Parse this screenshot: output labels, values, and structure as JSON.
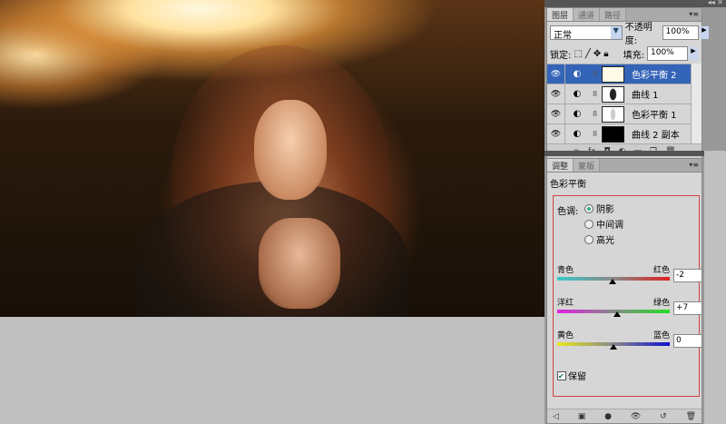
{
  "layers_panel": {
    "tabs": [
      "图层",
      "通道",
      "路径"
    ],
    "blend_mode": "正常",
    "opacity_label": "不透明度:",
    "opacity": "100%",
    "lock_label": "锁定:",
    "fill_label": "填充:",
    "fill": "100%",
    "layers": [
      {
        "name": "色彩平衡 2",
        "selected": true
      },
      {
        "name": "曲线 1",
        "selected": false
      },
      {
        "name": "色彩平衡 1",
        "selected": false
      },
      {
        "name": "曲线 2 副本",
        "selected": false
      }
    ]
  },
  "adjustments_panel": {
    "tabs": [
      "调整",
      "蒙版"
    ],
    "title": "色彩平衡",
    "tone_label": "色调:",
    "tones": [
      {
        "label": "阴影",
        "checked": true
      },
      {
        "label": "中间调",
        "checked": false
      },
      {
        "label": "高光",
        "checked": false
      }
    ],
    "sliders": [
      {
        "left": "青色",
        "right": "红色",
        "value": "-2",
        "level": -2,
        "gradient": [
          "#3cc8c8",
          "#e02020"
        ]
      },
      {
        "left": "洋红",
        "right": "绿色",
        "value": "+7",
        "level": 7,
        "gradient": [
          "#e020e0",
          "#20e020"
        ]
      },
      {
        "left": "黄色",
        "right": "蓝色",
        "value": "0",
        "level": 0,
        "gradient": [
          "#e8e820",
          "#1010d0"
        ]
      }
    ],
    "preserve_label": "保留",
    "preserve_checked": true
  }
}
